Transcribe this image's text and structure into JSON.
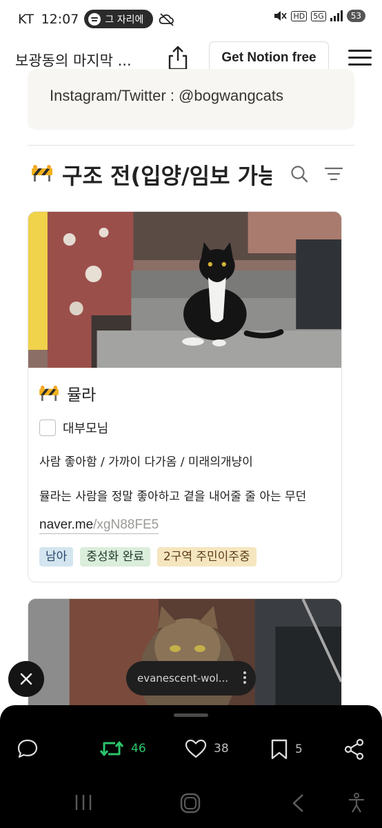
{
  "status_bar": {
    "carrier": "KT",
    "time": "12:07",
    "media_pill": "그 자리에",
    "network": "5G",
    "hd_badge": "HD",
    "battery": "53"
  },
  "header": {
    "page_title": "보광동의 마지막 ...",
    "cta_label": "Get Notion free"
  },
  "callout": {
    "text": "Instagram/Twitter : @bogwangcats"
  },
  "database": {
    "icon": "🚧",
    "title": "구조 전(입양/임보 가능)"
  },
  "cards": [
    {
      "icon": "🚧",
      "title": "뮬라",
      "checkbox_label": "대부모님",
      "checkbox_checked": false,
      "traits": "사람 좋아함 / 가까이 다가옴 / 미래의개냥이",
      "description": "뮬라는 사람을 정말 좋아하고 곁을 내어줄 줄 아는 무던",
      "link_domain": "naver.me",
      "link_path": "/xgN88FE5",
      "tags": [
        {
          "label": "남아",
          "bg": "#d3e5ef",
          "fg": "#28456c"
        },
        {
          "label": "중성화 완료",
          "bg": "#dbeddb",
          "fg": "#1c3829"
        },
        {
          "label": "2구역 주민이주중",
          "bg": "#f5e6c0",
          "fg": "#5c3b14"
        }
      ]
    }
  ],
  "toast": {
    "text": "evanescent-wol..."
  },
  "bottom_bar": {
    "repost_count": "46",
    "like_count": "38",
    "bookmark_count": "5",
    "repost_color": "#2cc46b"
  }
}
